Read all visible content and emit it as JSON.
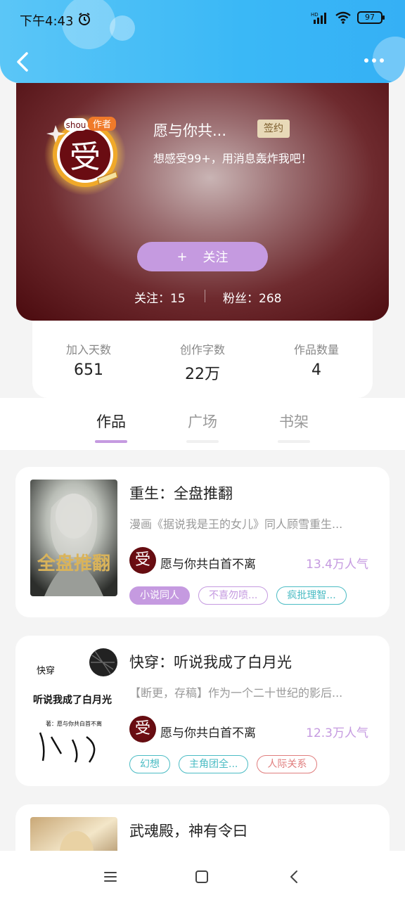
{
  "status_bar": {
    "time": "下午4:43",
    "battery": "97"
  },
  "profile": {
    "avatar_char": "受",
    "avatar_badge": "作者",
    "avatar_tag": "shou",
    "name": "愿与你共...",
    "badge": "签约",
    "bio": "想感受99+，用消息轰炸我吧！",
    "follow_label": "关注",
    "follow_icon": "+",
    "following": "关注：15",
    "fans": "粉丝：268"
  },
  "stats": [
    {
      "label": "加入天数",
      "value": "651"
    },
    {
      "label": "创作字数",
      "value": "22万"
    },
    {
      "label": "作品数量",
      "value": "4"
    }
  ],
  "tabs": [
    {
      "label": "作品",
      "active": true
    },
    {
      "label": "广场",
      "active": false
    },
    {
      "label": "书架",
      "active": false
    }
  ],
  "books": [
    {
      "title": "重生：全盘推翻",
      "desc": "漫画《据说我是王的女儿》同人顾雪重生...",
      "author": "愿与你共白首不离",
      "author_avatar": "受",
      "popularity": "13.4万人气",
      "cover_text": "全盘推翻",
      "tags": [
        {
          "label": "小说同人",
          "style": "filled"
        },
        {
          "label": "不喜勿喷...",
          "style": "purple"
        },
        {
          "label": "疯批理智...",
          "style": "teal"
        }
      ]
    },
    {
      "title": "快穿：听说我成了白月光",
      "desc": "【断更，存稿】作为一个二十世纪的影后...",
      "author": "愿与你共白首不离",
      "author_avatar": "受",
      "popularity": "12.3万人气",
      "cover_text_1": "快穿",
      "cover_text_2": "听说我成了白月光",
      "cover_text_3": "著：愿与你共白首不离",
      "tags": [
        {
          "label": "幻想",
          "style": "teal"
        },
        {
          "label": "主角团全...",
          "style": "teal"
        },
        {
          "label": "人际关系",
          "style": "red"
        }
      ]
    },
    {
      "title": "武魂殿，神有令曰"
    }
  ],
  "colors": {
    "header": "#3ab8f6",
    "accent": "#c59ae0",
    "banner_dark": "#4a0a0e"
  }
}
